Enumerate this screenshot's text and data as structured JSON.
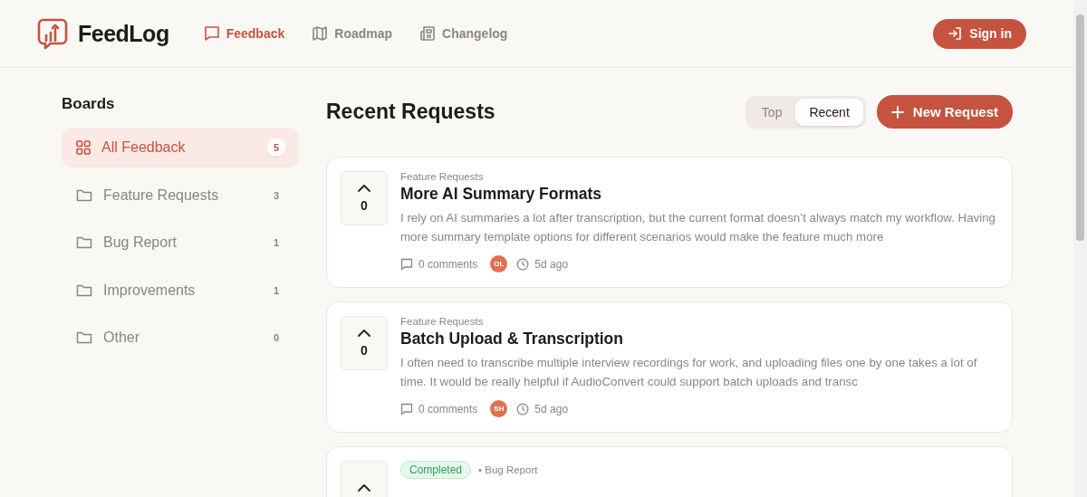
{
  "header": {
    "brand": "FeedLog",
    "nav": [
      {
        "label": "Feedback",
        "kind": "chat",
        "selected": true
      },
      {
        "label": "Roadmap",
        "kind": "map",
        "selected": false
      },
      {
        "label": "Changelog",
        "kind": "news",
        "selected": false
      }
    ],
    "sign_in": "Sign in"
  },
  "sidebar": {
    "title": "Boards",
    "items": [
      {
        "label": "All Feedback",
        "count": "5",
        "kind": "all",
        "selected": true
      },
      {
        "label": "Feature Requests",
        "count": "3",
        "kind": "board",
        "selected": false
      },
      {
        "label": "Bug Report",
        "count": "1",
        "kind": "board",
        "selected": false
      },
      {
        "label": "Improvements",
        "count": "1",
        "kind": "board",
        "selected": false
      },
      {
        "label": "Other",
        "count": "0",
        "kind": "board",
        "selected": false
      }
    ]
  },
  "main": {
    "title": "Recent Requests",
    "sort_tabs": [
      {
        "label": "Top",
        "selected": false
      },
      {
        "label": "Recent",
        "selected": true
      }
    ],
    "new_button": "New Request",
    "requests": [
      {
        "votes": "0",
        "board": "Feature Requests",
        "title": "More AI Summary Formats",
        "body": "I rely on AI summaries a lot after transcription, but the current format doesn’t always match my workflow. Having more summary template options for different scenarios would make the feature much more",
        "comments": "0 comments",
        "author": "OL",
        "time": "5d ago"
      },
      {
        "votes": "0",
        "board": "Feature Requests",
        "title": "Batch Upload & Transcription",
        "body": "I often need to transcribe multiple interview recordings for work, and uploading files one by one takes a lot of time. It would be really helpful if AudioConvert could support batch uploads and transc",
        "comments": "0 comments",
        "author": "SH",
        "time": "5d ago"
      },
      {
        "status": {
          "label": "Completed",
          "kind": "completed"
        },
        "board": "• Bug Report"
      }
    ]
  }
}
